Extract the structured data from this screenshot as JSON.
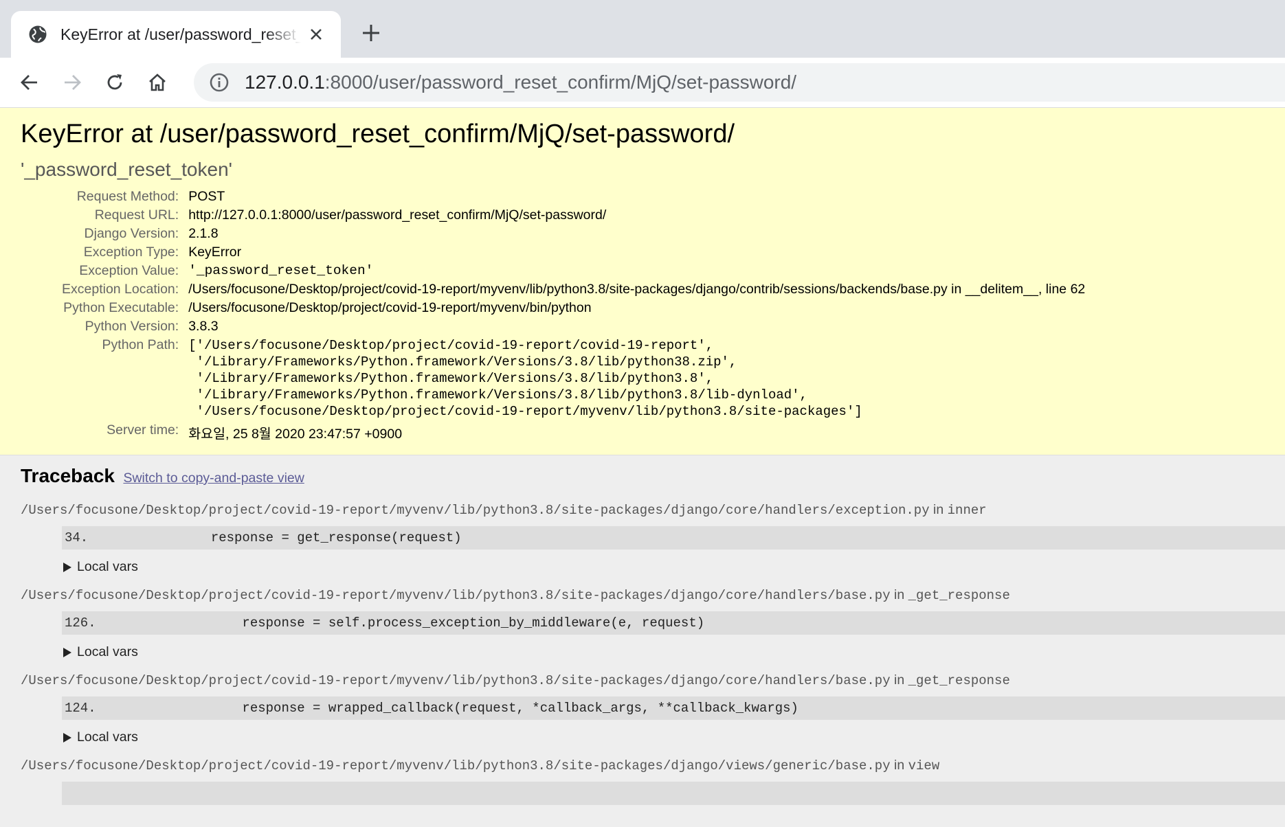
{
  "browser": {
    "tab_title": "KeyError at /user/password_reset_confirm/MjQ/set-password/",
    "url_host": "127.0.0.1",
    "url_rest": ":8000/user/password_reset_confirm/MjQ/set-password/"
  },
  "summary": {
    "title": "KeyError at /user/password_reset_confirm/MjQ/set-password/",
    "exception_value": "'_password_reset_token'",
    "rows": [
      {
        "label": "Request Method:",
        "value": "POST"
      },
      {
        "label": "Request URL:",
        "value": "http://127.0.0.1:8000/user/password_reset_confirm/MjQ/set-password/"
      },
      {
        "label": "Django Version:",
        "value": "2.1.8"
      },
      {
        "label": "Exception Type:",
        "value": "KeyError"
      },
      {
        "label": "Exception Value:",
        "value": "'_password_reset_token'"
      },
      {
        "label": "Exception Location:",
        "value": "/Users/focusone/Desktop/project/covid-19-report/myvenv/lib/python3.8/site-packages/django/contrib/sessions/backends/base.py in __delitem__, line 62"
      },
      {
        "label": "Python Executable:",
        "value": "/Users/focusone/Desktop/project/covid-19-report/myvenv/bin/python"
      },
      {
        "label": "Python Version:",
        "value": "3.8.3"
      },
      {
        "label": "Python Path:",
        "value": ""
      },
      {
        "label": "Server time:",
        "value": "화요일, 25 8월 2020 23:47:57 +0900"
      }
    ],
    "python_path": [
      "['/Users/focusone/Desktop/project/covid-19-report/covid-19-report',",
      " '/Library/Frameworks/Python.framework/Versions/3.8/lib/python38.zip',",
      " '/Library/Frameworks/Python.framework/Versions/3.8/lib/python3.8',",
      " '/Library/Frameworks/Python.framework/Versions/3.8/lib/python3.8/lib-dynload',",
      " '/Users/focusone/Desktop/project/covid-19-report/myvenv/lib/python3.8/site-packages']"
    ]
  },
  "traceback": {
    "heading": "Traceback",
    "switch_link": "Switch to copy-and-paste view",
    "in_word": "in",
    "local_vars_label": "Local vars",
    "frames": [
      {
        "path": "/Users/focusone/Desktop/project/covid-19-report/myvenv/lib/python3.8/site-packages/django/core/handlers/exception.py",
        "function": "inner",
        "lineno": "34.",
        "code": "            response = get_response(request)"
      },
      {
        "path": "/Users/focusone/Desktop/project/covid-19-report/myvenv/lib/python3.8/site-packages/django/core/handlers/base.py",
        "function": "_get_response",
        "lineno": "126.",
        "code": "                response = self.process_exception_by_middleware(e, request)"
      },
      {
        "path": "/Users/focusone/Desktop/project/covid-19-report/myvenv/lib/python3.8/site-packages/django/core/handlers/base.py",
        "function": "_get_response",
        "lineno": "124.",
        "code": "                response = wrapped_callback(request, *callback_args, **callback_kwargs)"
      },
      {
        "path": "/Users/focusone/Desktop/project/covid-19-report/myvenv/lib/python3.8/site-packages/django/views/generic/base.py",
        "function": "view",
        "lineno": "",
        "code": ""
      }
    ]
  }
}
